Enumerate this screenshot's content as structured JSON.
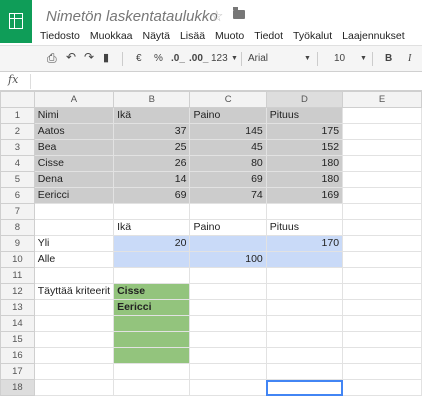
{
  "app": {
    "title": "Nimetön laskentataulukko"
  },
  "menu": [
    "Tiedosto",
    "Muokkaa",
    "Näytä",
    "Lisää",
    "Muoto",
    "Tiedot",
    "Työkalut",
    "Laajennukset"
  ],
  "toolbar": {
    "currency": "€",
    "percent": "%",
    "decrease_decimals": ".0_",
    "increase_decimals": ".00_",
    "more_formats": "123",
    "font": "Arial",
    "font_size": "10",
    "bold": "B",
    "italic": "I"
  },
  "formula_bar": {
    "fx": "fx",
    "value": ""
  },
  "columns": [
    "A",
    "B",
    "C",
    "D",
    "E"
  ],
  "rows": [
    {
      "n": "1",
      "cells": [
        "Nimi",
        "Ikä",
        "Paino",
        "Pituus",
        ""
      ]
    },
    {
      "n": "2",
      "cells": [
        "Aatos",
        "37",
        "145",
        "175",
        ""
      ]
    },
    {
      "n": "3",
      "cells": [
        "Bea",
        "25",
        "45",
        "152",
        ""
      ]
    },
    {
      "n": "4",
      "cells": [
        "Cisse",
        "26",
        "80",
        "180",
        ""
      ]
    },
    {
      "n": "5",
      "cells": [
        "Dena",
        "14",
        "69",
        "180",
        ""
      ]
    },
    {
      "n": "6",
      "cells": [
        "Eericci",
        "69",
        "74",
        "169",
        ""
      ]
    },
    {
      "n": "7",
      "cells": [
        "",
        "",
        "",
        "",
        ""
      ]
    },
    {
      "n": "8",
      "cells": [
        "",
        "Ikä",
        "Paino",
        "Pituus",
        ""
      ]
    },
    {
      "n": "9",
      "cells": [
        "Yli",
        "20",
        "",
        "170",
        ""
      ]
    },
    {
      "n": "10",
      "cells": [
        "Alle",
        "",
        "100",
        "",
        ""
      ]
    },
    {
      "n": "11",
      "cells": [
        "",
        "",
        "",
        "",
        ""
      ]
    },
    {
      "n": "12",
      "cells": [
        "Täyttää kriteerit",
        "Cisse",
        "",
        "",
        ""
      ]
    },
    {
      "n": "13",
      "cells": [
        "",
        "Eericci",
        "",
        "",
        ""
      ]
    },
    {
      "n": "14",
      "cells": [
        "",
        "",
        "",
        "",
        ""
      ]
    },
    {
      "n": "15",
      "cells": [
        "",
        "",
        "",
        "",
        ""
      ]
    },
    {
      "n": "16",
      "cells": [
        "",
        "",
        "",
        "",
        ""
      ]
    },
    {
      "n": "17",
      "cells": [
        "",
        "",
        "",
        "",
        ""
      ]
    },
    {
      "n": "18",
      "cells": [
        "",
        "",
        "",
        "",
        ""
      ]
    }
  ],
  "colors": {
    "brand": "#0f9d58",
    "gray_fill": "#cccccc",
    "blue_fill": "#c9daf8",
    "green_fill": "#93c47d",
    "selection": "#4285f4"
  }
}
